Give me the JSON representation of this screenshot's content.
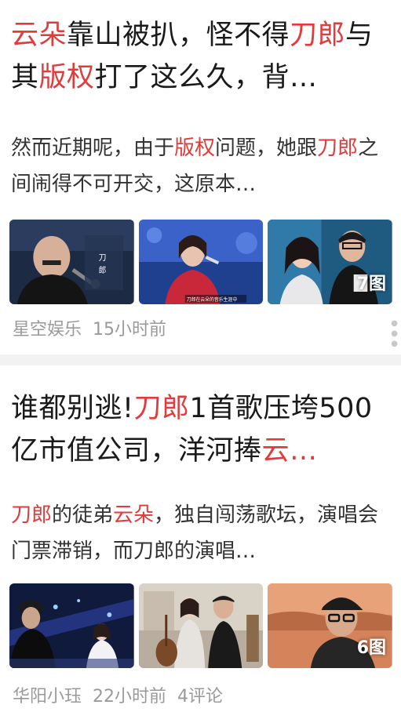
{
  "colors": {
    "highlight": "#e23b3b",
    "meta_text": "#9a9a9a",
    "separator": "#f2f2f2"
  },
  "articles": [
    {
      "title_parts": [
        {
          "text": "云朵",
          "hl": true
        },
        {
          "text": "靠山被扒，怪不得",
          "hl": false
        },
        {
          "text": "刀郎",
          "hl": true
        },
        {
          "text": "与其",
          "hl": false
        },
        {
          "text": "版权",
          "hl": true
        },
        {
          "text": "打了这么久，背…",
          "hl": false
        }
      ],
      "summary_parts": [
        {
          "text": "然而近期呢，由于",
          "hl": false
        },
        {
          "text": "版权",
          "hl": true
        },
        {
          "text": "问题，她跟",
          "hl": false
        },
        {
          "text": "刀郎",
          "hl": true
        },
        {
          "text": "之间闹得不可开交，这原本…",
          "hl": false
        }
      ],
      "thumbnails": [
        {
          "icon": "bald-man-microphone-photo",
          "caption": "刀\n郎"
        },
        {
          "icon": "woman-singing-stage-photo",
          "caption": "刀郎在云朵的音乐生涯中"
        },
        {
          "icon": "couple-portrait-photo",
          "caption": ""
        }
      ],
      "image_count": "7图",
      "source": "星空娱乐",
      "time": "15小时前",
      "comments": ""
    },
    {
      "title_parts": [
        {
          "text": "谁都别逃!",
          "hl": false
        },
        {
          "text": "刀郎",
          "hl": true
        },
        {
          "text": "1首歌压垮500亿市值公司，洋河捧",
          "hl": false
        },
        {
          "text": "云…",
          "hl": true
        }
      ],
      "summary_parts": [
        {
          "text": "刀郎",
          "hl": true
        },
        {
          "text": "的徒弟",
          "hl": false
        },
        {
          "text": "云朵",
          "hl": true
        },
        {
          "text": "，独自闯荡歌坛，演唱会门票滞销，而刀郎的演唱…",
          "hl": false
        }
      ],
      "thumbnails": [
        {
          "icon": "concert-stage-photo",
          "caption": ""
        },
        {
          "icon": "studio-duo-photo",
          "caption": ""
        },
        {
          "icon": "man-cap-glasses-photo",
          "caption": ""
        }
      ],
      "image_count": "6图",
      "source": "华阳小珏",
      "time": "22小时前",
      "comments": "4评论"
    }
  ]
}
